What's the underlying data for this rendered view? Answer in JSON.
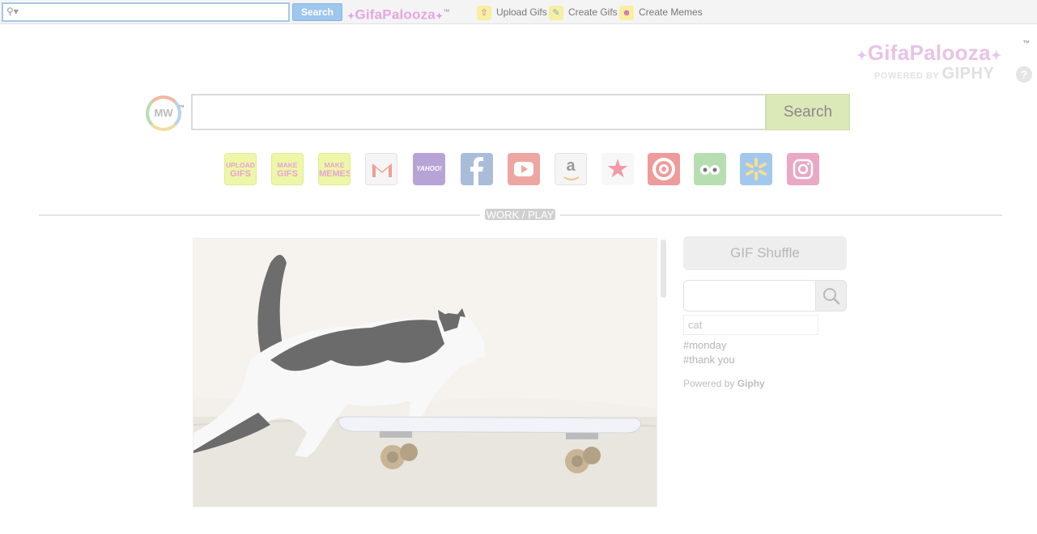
{
  "toolbar": {
    "search_placeholder": "",
    "search_button": "Search",
    "logo_text": "GifaPalooza",
    "logo_tm": "™",
    "links": [
      {
        "label": "Upload Gifs",
        "icon": "upload-icon"
      },
      {
        "label": "Create Gifs",
        "icon": "pencil-icon"
      },
      {
        "label": "Create Memes",
        "icon": "smiley-icon"
      }
    ]
  },
  "brand": {
    "logo_text": "GifaPalooza",
    "tm": "™",
    "powered_prefix": "POWERED BY",
    "powered_name": "GIPHY",
    "help": "?"
  },
  "search": {
    "mw_logo": "MW",
    "mw_tm": "™",
    "value": "",
    "button": "Search"
  },
  "tiles": [
    {
      "name": "upload-gifs-tile",
      "line1": "UPLOAD",
      "line2": "GIFS",
      "bg": "#eef7a8"
    },
    {
      "name": "make-gifs-tile",
      "line1": "MAKE",
      "line2": "GIFS",
      "bg": "#eef7a8"
    },
    {
      "name": "make-memes-tile",
      "line1": "MAKE",
      "line2": "MEMES",
      "bg": "#eef7a8"
    },
    {
      "name": "gmail-tile",
      "icon": "gmail-icon",
      "bg": "#f3f3f3"
    },
    {
      "name": "yahoo-tile",
      "icon": "yahoo-icon",
      "label": "YAHOO!",
      "bg": "#b8a3d6"
    },
    {
      "name": "facebook-tile",
      "icon": "facebook-icon",
      "bg": "#a9bddb"
    },
    {
      "name": "youtube-tile",
      "icon": "youtube-icon",
      "bg": "#eea6a3"
    },
    {
      "name": "amazon-tile",
      "icon": "amazon-icon",
      "bg": "#f3f3f3"
    },
    {
      "name": "favorites-tile",
      "icon": "star-icon",
      "bg": "#f7f7f7"
    },
    {
      "name": "target-tile",
      "icon": "target-icon",
      "bg": "#ee9b9b"
    },
    {
      "name": "tripadvisor-tile",
      "icon": "tripadvisor-icon",
      "bg": "#b7deb0"
    },
    {
      "name": "walmart-tile",
      "icon": "walmart-icon",
      "bg": "#a3c8ee"
    },
    {
      "name": "instagram-tile",
      "icon": "instagram-icon",
      "bg": "#e8a8c6"
    }
  ],
  "divider_label": "WORK / PLAY",
  "panel": {
    "shuffle_button": "GIF Shuffle",
    "search_value": "",
    "suggestion": "cat",
    "tags": [
      "#monday",
      "#thank you"
    ],
    "powered_prefix": "Powered by",
    "powered_name": "Giphy"
  },
  "colors": {
    "accent_blue": "#9ec7ee",
    "search_green": "#dbe8b8"
  }
}
